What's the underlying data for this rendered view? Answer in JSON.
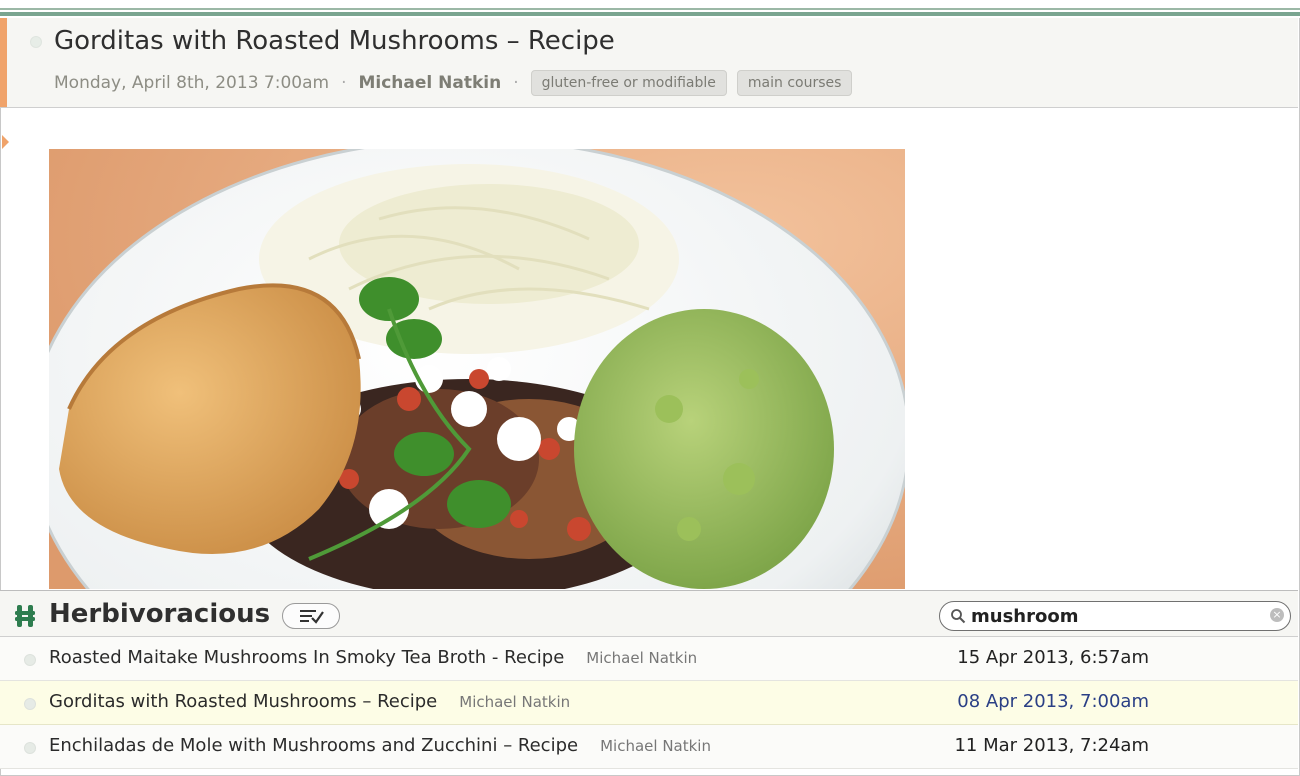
{
  "article": {
    "title": "Gorditas with Roasted Mushrooms – Recipe",
    "date": "Monday, April 8th, 2013 7:00am",
    "separator": "·",
    "author": "Michael Natkin",
    "separator2": "·",
    "tags": [
      "gluten-free or modifiable",
      "main courses"
    ],
    "image_icon": "food-photo"
  },
  "reader": {
    "app_name": "Herbivoracious",
    "app_icon": "h-logo-icon",
    "search": {
      "value": "mushroom",
      "placeholder": ""
    },
    "accent_color": "#2e7d4f"
  },
  "list": {
    "items": [
      {
        "title": "Roasted Maitake Mushrooms In Smoky Tea Broth - Recipe",
        "author": "Michael Natkin",
        "date": "15 Apr 2013, 6:57am"
      },
      {
        "title": "Gorditas with Roasted Mushrooms – Recipe",
        "author": "Michael Natkin",
        "date": "08 Apr 2013, 7:00am",
        "selected": true
      },
      {
        "title": "Enchiladas de Mole with Mushrooms and Zucchini – Recipe",
        "author": "Michael Natkin",
        "date": "11 Mar 2013, 7:24am"
      }
    ]
  }
}
